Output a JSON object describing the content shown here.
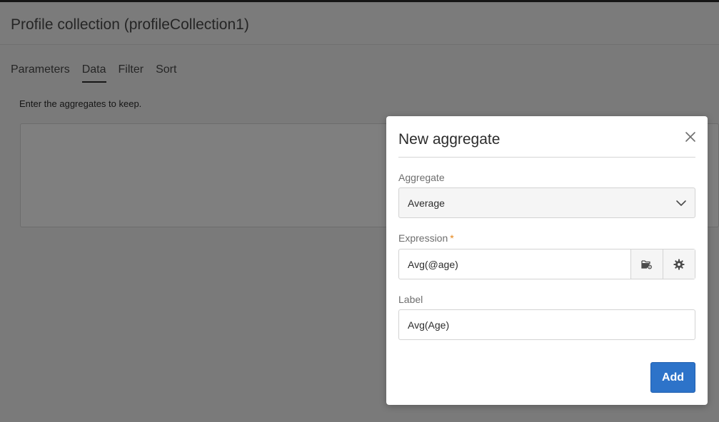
{
  "background": {
    "title": "Profile collection (profileCollection1)",
    "tabs": [
      {
        "label": "Parameters",
        "active": false
      },
      {
        "label": "Data",
        "active": true
      },
      {
        "label": "Filter",
        "active": false
      },
      {
        "label": "Sort",
        "active": false
      }
    ],
    "hint": "Enter the aggregates to keep."
  },
  "modal": {
    "title": "New aggregate",
    "close_icon": "close-icon",
    "aggregate": {
      "label": "Aggregate",
      "value": "Average",
      "icon": "chevron-down-icon"
    },
    "expression": {
      "label": "Expression",
      "required_mark": "*",
      "value": "Avg(@age)",
      "buttons": [
        {
          "icon": "folder-settings-icon"
        },
        {
          "icon": "gear-icon"
        }
      ]
    },
    "label_field": {
      "label": "Label",
      "value": "Avg(Age)"
    },
    "add_label": "Add"
  },
  "colors": {
    "primary": "#2d73c9",
    "required": "#e68619"
  }
}
